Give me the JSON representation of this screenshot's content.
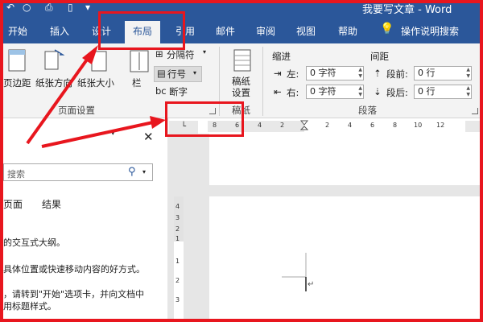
{
  "titlebar": {
    "title": "我要写文章 - Word"
  },
  "ribbon_tabs": [
    "开始",
    "插入",
    "设计",
    "布局",
    "引用",
    "邮件",
    "审阅",
    "视图",
    "帮助",
    "操作说明搜索"
  ],
  "page_setup": {
    "margins": "页边距",
    "orientation": "纸张方向",
    "size": "纸张大小",
    "columns": "栏",
    "breaks": "分隔符",
    "line_numbers": "行号",
    "hyphenation": "断字",
    "group_title": "页面设置"
  },
  "manuscript": {
    "label": "稿纸\n设置",
    "group_title": "稿纸"
  },
  "paragraph": {
    "indent_label": "缩进",
    "spacing_label": "间距",
    "left_label": "左:",
    "right_label": "右:",
    "left_value": "0 字符",
    "right_value": "0 字符",
    "before_label": "段前:",
    "after_label": "段后:",
    "before_value": "0 行",
    "after_value": "0 行",
    "group_title": "段落"
  },
  "nav": {
    "search_placeholder": "搜索",
    "tab_pages": "页面",
    "tab_results": "结果",
    "line1": "的交互式大纲。",
    "line2": "具体位置或快速移动内容的好方式。",
    "line3": "，请转到\"开始\"选项卡，并向文档中",
    "line4": "用标题样式。"
  },
  "ruler": {
    "ticks": [
      "8",
      "6",
      "4",
      "2",
      "2",
      "4",
      "6",
      "8",
      "10",
      "12"
    ],
    "vticks": [
      "4",
      "3",
      "2",
      "1",
      "1",
      "2",
      "3"
    ]
  },
  "colors": {
    "ribbon": "#2b579a",
    "annotation": "#e8161e"
  }
}
